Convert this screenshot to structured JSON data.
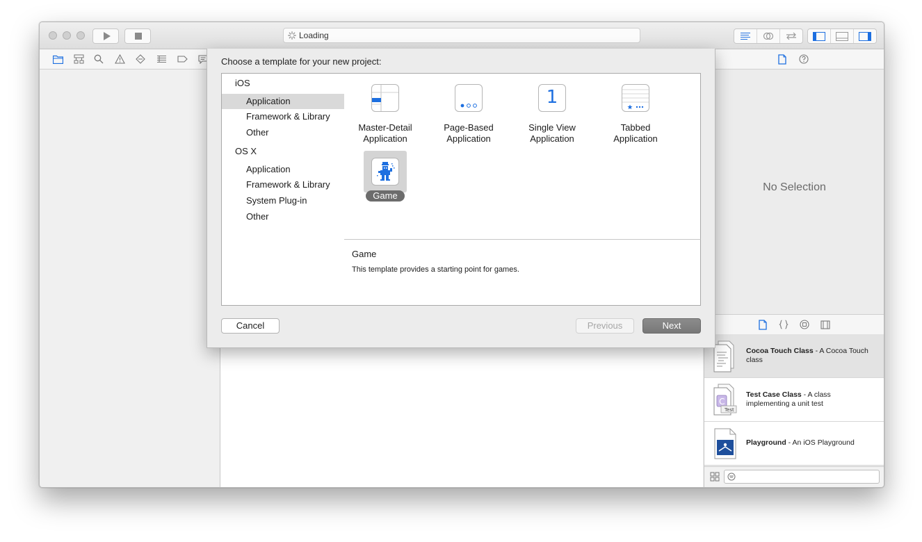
{
  "toolbar": {
    "activity_text": "Loading"
  },
  "sheet": {
    "title": "Choose a template for your new project:",
    "categories": [
      {
        "label": "iOS",
        "type": "group"
      },
      {
        "label": "Application",
        "type": "item",
        "selected": true
      },
      {
        "label": "Framework & Library",
        "type": "item"
      },
      {
        "label": "Other",
        "type": "item"
      },
      {
        "label": "OS X",
        "type": "group"
      },
      {
        "label": "Application",
        "type": "item"
      },
      {
        "label": "Framework & Library",
        "type": "item"
      },
      {
        "label": "System Plug-in",
        "type": "item"
      },
      {
        "label": "Other",
        "type": "item"
      }
    ],
    "templates": [
      {
        "line1": "Master-Detail",
        "line2": "Application",
        "icon": "master-detail-icon"
      },
      {
        "line1": "Page-Based",
        "line2": "Application",
        "icon": "page-based-icon"
      },
      {
        "line1": "Single View",
        "line2": "Application",
        "icon": "single-view-icon",
        "glyph": "1"
      },
      {
        "line1": "Tabbed",
        "line2": "Application",
        "icon": "tabbed-icon"
      },
      {
        "line1": "Game",
        "line2": "",
        "icon": "game-icon",
        "selected": true
      }
    ],
    "description": {
      "title": "Game",
      "text": "This template provides a starting point for games."
    },
    "buttons": {
      "cancel": "Cancel",
      "previous": "Previous",
      "next": "Next"
    }
  },
  "inspector": {
    "empty_text": "No Selection"
  },
  "library": {
    "items": [
      {
        "name": "Cocoa Touch Class",
        "desc": " - A Cocoa Touch class",
        "icon": "cocoa-touch-class-icon"
      },
      {
        "name": "Test Case Class",
        "desc": " - A class implementing a unit test",
        "icon": "test-case-class-icon",
        "badge": "Test"
      },
      {
        "name": "Playground",
        "desc": " - An iOS Playground",
        "icon": "playground-icon"
      }
    ]
  },
  "colors": {
    "accent": "#1d6fe0",
    "selection_gray": "#d9d9d9",
    "pill_gray": "#6c6c6c"
  }
}
